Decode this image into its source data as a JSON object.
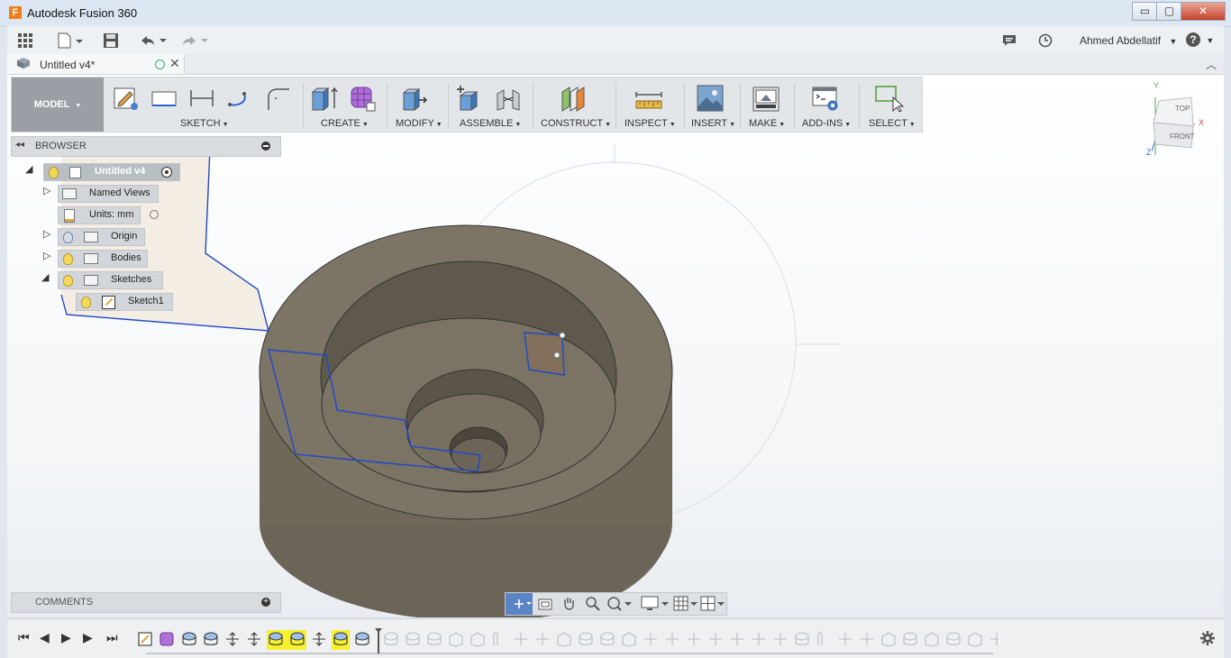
{
  "window": {
    "title": "Autodesk Fusion 360",
    "app_icon_letter": "F",
    "minimize": "▭",
    "maximize": "▢",
    "close": "✕"
  },
  "quick_access": {
    "user_name": "Ahmed Abdellatif",
    "help": "?"
  },
  "document_tab": {
    "label": "Untitled v4*"
  },
  "toolbar": {
    "workspace": "MODEL",
    "groups": [
      "SKETCH",
      "CREATE",
      "MODIFY",
      "ASSEMBLE",
      "CONSTRUCT",
      "INSPECT",
      "INSERT",
      "MAKE",
      "ADD-INS",
      "SELECT"
    ]
  },
  "browser": {
    "title": "BROWSER",
    "root": "Untitled v4",
    "items": {
      "named_views": "Named Views",
      "units": "Units: mm",
      "origin": "Origin",
      "bodies": "Bodies",
      "sketches": "Sketches",
      "sketch1": "Sketch1"
    }
  },
  "comments": {
    "title": "COMMENTS"
  },
  "viewcube": {
    "top": "TOP",
    "front": "FRONT",
    "axis_x": "X",
    "axis_y": "Y",
    "axis_z": "Z"
  },
  "colors": {
    "body": "#6e6759",
    "sketch_line": "#1f49c8",
    "highlight": "#f5f132",
    "accent": "#f07d1b"
  }
}
